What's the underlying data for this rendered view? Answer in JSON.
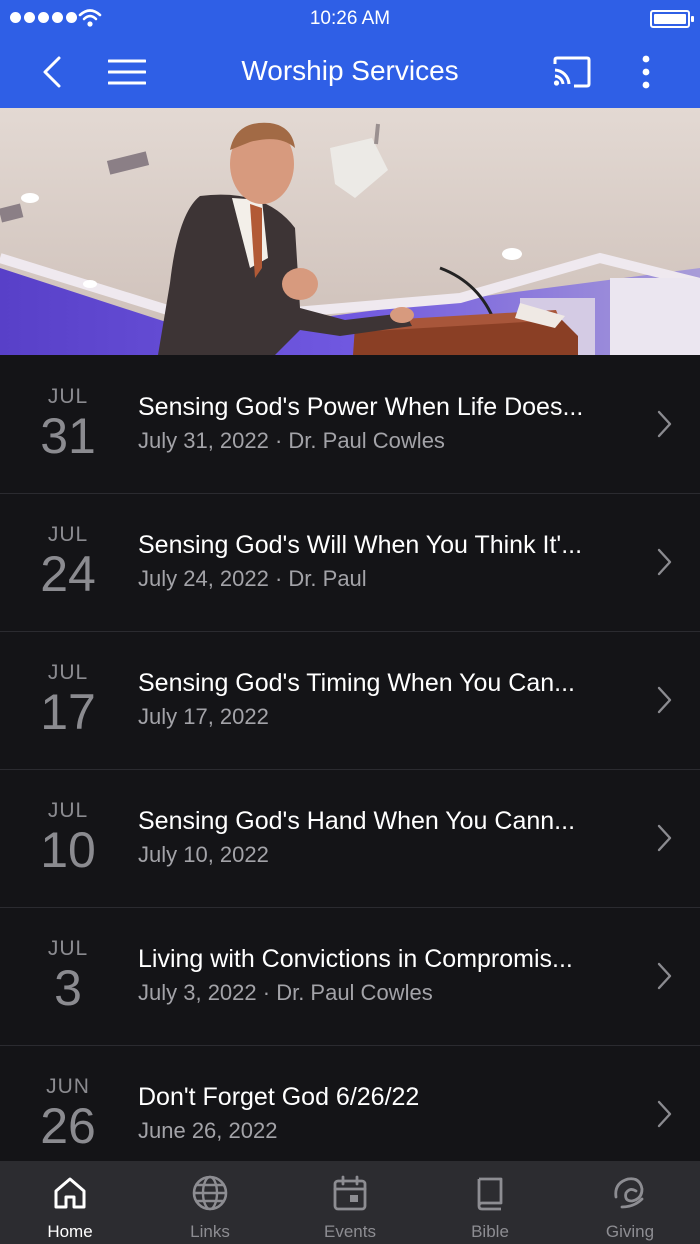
{
  "status_bar": {
    "time": "10:26 AM"
  },
  "header": {
    "title": "Worship Services"
  },
  "sermons": [
    {
      "month": "JUL",
      "day": "31",
      "title": "Sensing God's Power When Life Does...",
      "subtitle": "July 31, 2022 · Dr. Paul Cowles"
    },
    {
      "month": "JUL",
      "day": "24",
      "title": "Sensing God's Will When You Think It'...",
      "subtitle": "July 24, 2022 · Dr. Paul"
    },
    {
      "month": "JUL",
      "day": "17",
      "title": "Sensing God's Timing When You Can...",
      "subtitle": "July 17, 2022"
    },
    {
      "month": "JUL",
      "day": "10",
      "title": "Sensing God's Hand When You Cann...",
      "subtitle": "July 10, 2022"
    },
    {
      "month": "JUL",
      "day": "3",
      "title": "Living with Convictions in Compromis...",
      "subtitle": "July 3, 2022 · Dr. Paul Cowles"
    },
    {
      "month": "JUN",
      "day": "26",
      "title": "Don't Forget God 6/26/22",
      "subtitle": "June 26, 2022"
    }
  ],
  "tabs": [
    {
      "label": "Home",
      "icon": "home-icon",
      "active": true
    },
    {
      "label": "Links",
      "icon": "globe-icon",
      "active": false
    },
    {
      "label": "Events",
      "icon": "calendar-icon",
      "active": false
    },
    {
      "label": "Bible",
      "icon": "book-icon",
      "active": false
    },
    {
      "label": "Giving",
      "icon": "giving-icon",
      "active": false
    }
  ],
  "colors": {
    "header": "#2f5fe6",
    "background": "#141417",
    "tabbar": "#2c2c30"
  }
}
